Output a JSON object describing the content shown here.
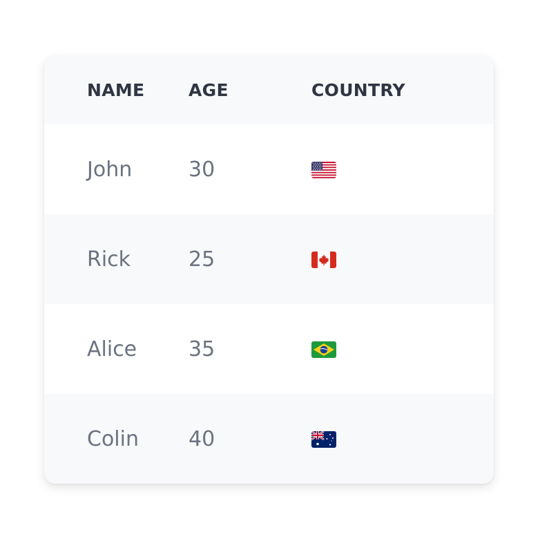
{
  "table": {
    "headers": {
      "name": "NAME",
      "age": "AGE",
      "country": "COUNTRY"
    },
    "rows": [
      {
        "name": "John",
        "age": "30",
        "country_flag": "usa-flag-icon"
      },
      {
        "name": "Rick",
        "age": "25",
        "country_flag": "canada-flag-icon"
      },
      {
        "name": "Alice",
        "age": "35",
        "country_flag": "brazil-flag-icon"
      },
      {
        "name": "Colin",
        "age": "40",
        "country_flag": "australia-flag-icon"
      }
    ]
  },
  "colors": {
    "header_text": "#2f3542",
    "cell_text": "#6b7280",
    "alt_row_bg": "#f8f9fb"
  }
}
